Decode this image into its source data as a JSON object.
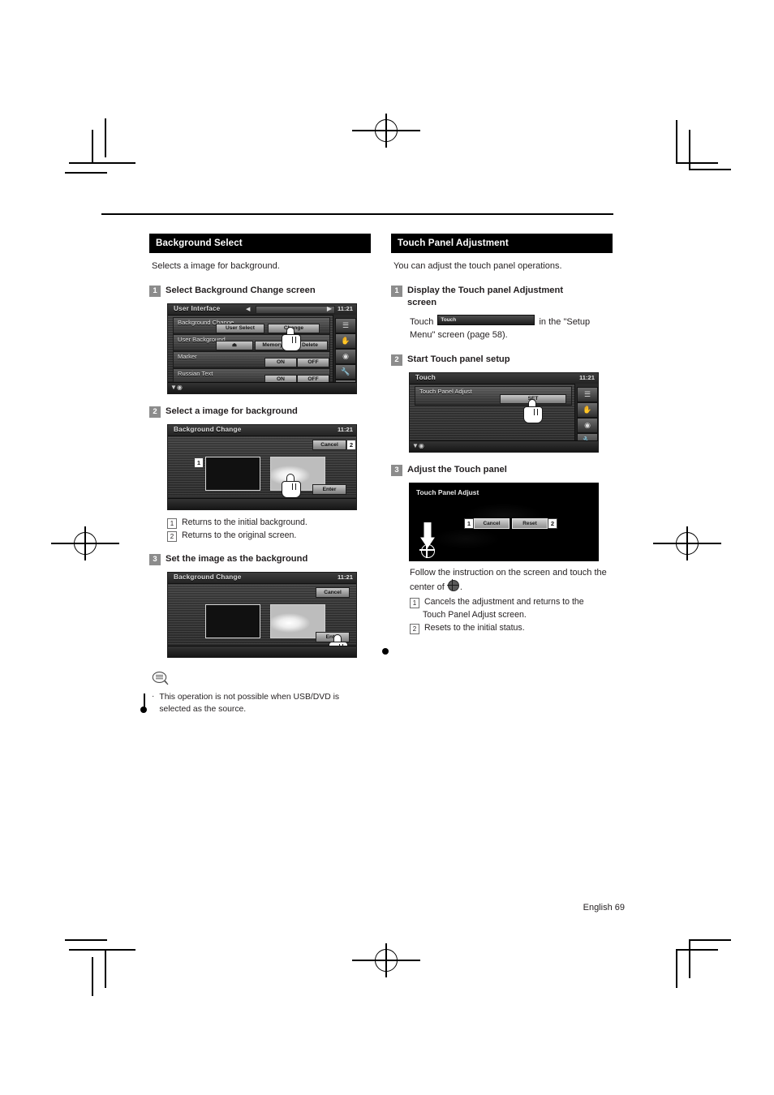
{
  "page": {
    "footer_language": "English",
    "page_number": "69"
  },
  "left_column": {
    "section_title": "Background Select",
    "lead": "Selects a image for background.",
    "steps": [
      {
        "num": "1",
        "label": "Select Background Change screen"
      },
      {
        "num": "2",
        "label": "Select a image for background"
      },
      {
        "num": "3",
        "label": "Set the image as the background"
      }
    ],
    "screen_user_interface": {
      "title": "User Interface",
      "clock": "11:21",
      "rows": [
        {
          "label": "Background Change",
          "buttons": [
            "User Select",
            "Change"
          ]
        },
        {
          "label": "User Background",
          "buttons": [
            "⏏",
            "Memory",
            "Delete"
          ]
        },
        {
          "label": "Marker",
          "buttons": [
            "ON",
            "OFF"
          ]
        },
        {
          "label": "Russian Text",
          "buttons": [
            "ON",
            "OFF"
          ]
        }
      ]
    },
    "screen_background_change_1": {
      "title": "Background Change",
      "clock": "11:21",
      "cancel_label": "Cancel",
      "enter_label": "Enter",
      "callout_thumb": "1",
      "callout_cancel": "2"
    },
    "screen_background_change_2": {
      "title": "Background Change",
      "clock": "11:21",
      "cancel_label": "Cancel",
      "enter_label": "Enter"
    },
    "references": [
      {
        "num": "1",
        "text": "Returns to the initial background."
      },
      {
        "num": "2",
        "text": "Returns to the original screen."
      }
    ],
    "note": {
      "bullet": "·",
      "text": "This operation is not possible when USB/DVD is selected as the source."
    }
  },
  "right_column": {
    "section_title": "Touch Panel Adjustment",
    "lead": "You can adjust the touch panel operations.",
    "steps": [
      {
        "num": "1",
        "label": "Display the Touch panel Adjustment screen"
      },
      {
        "num": "2",
        "label": "Start Touch panel setup"
      },
      {
        "num": "3",
        "label": "Adjust the Touch panel"
      }
    ],
    "step1_text_before": "Touch",
    "step1_button_label": "Touch",
    "step1_text_after": "in the \"Setup Menu\" screen (page 58).",
    "screen_touch": {
      "title": "Touch",
      "clock": "11:21",
      "row_label": "Touch Panel Adjust",
      "button_label": "SET"
    },
    "screen_touch_panel_adjust": {
      "title": "Touch Panel Adjust",
      "button_1_label": "Cancel",
      "button_2_label": "Reset",
      "callout_1": "1",
      "callout_2": "2"
    },
    "instruction_line1": "Follow the instruction on the screen and touch",
    "instruction_line2_before": "the center of",
    "instruction_line2_after": ".",
    "references": [
      {
        "num": "1",
        "text": "Cancels the adjustment and returns to the",
        "cont": "Touch Panel Adjust screen."
      },
      {
        "num": "2",
        "text": "Resets to the initial status."
      }
    ]
  }
}
